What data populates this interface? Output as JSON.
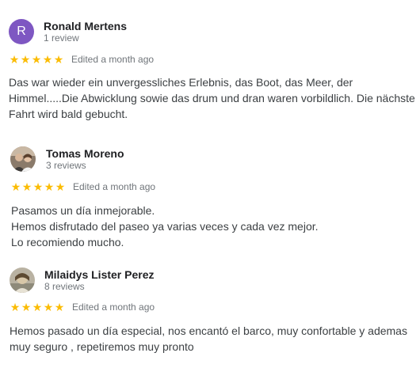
{
  "reviews": [
    {
      "avatar_letter": "R",
      "avatar_color": "#7e57c2",
      "name": "Ronald Mertens",
      "count": "1 review",
      "stars": 5,
      "edited": "Edited a month ago",
      "text": "Das war wieder ein unvergessliches Erlebnis, das Boot, das Meer, der\nHimmel.....Die Abwicklung sowie das drum und dran waren vorbildlich. Die nächste\nFahrt wird bald gebucht."
    },
    {
      "avatar_icon": "profile-photo-icon",
      "name": "Tomas Moreno",
      "count": "3 reviews",
      "stars": 5,
      "edited": "Edited a month ago",
      "text": "Pasamos un día inmejorable.\nHemos disfrutado del paseo ya varias veces y cada vez mejor.\nLo recomiendo mucho."
    },
    {
      "avatar_icon": "profile-photo-icon",
      "name": "Milaidys Lister Perez",
      "count": "8 reviews",
      "stars": 5,
      "edited": "Edited a month ago",
      "text": "Hemos pasado un día especial, nos encantó el barco, muy confortable y ademas\nmuy seguro , repetiremos muy pronto"
    }
  ],
  "colors": {
    "star": "#fbbc04",
    "meta": "#70757a",
    "text": "#3c4043"
  }
}
